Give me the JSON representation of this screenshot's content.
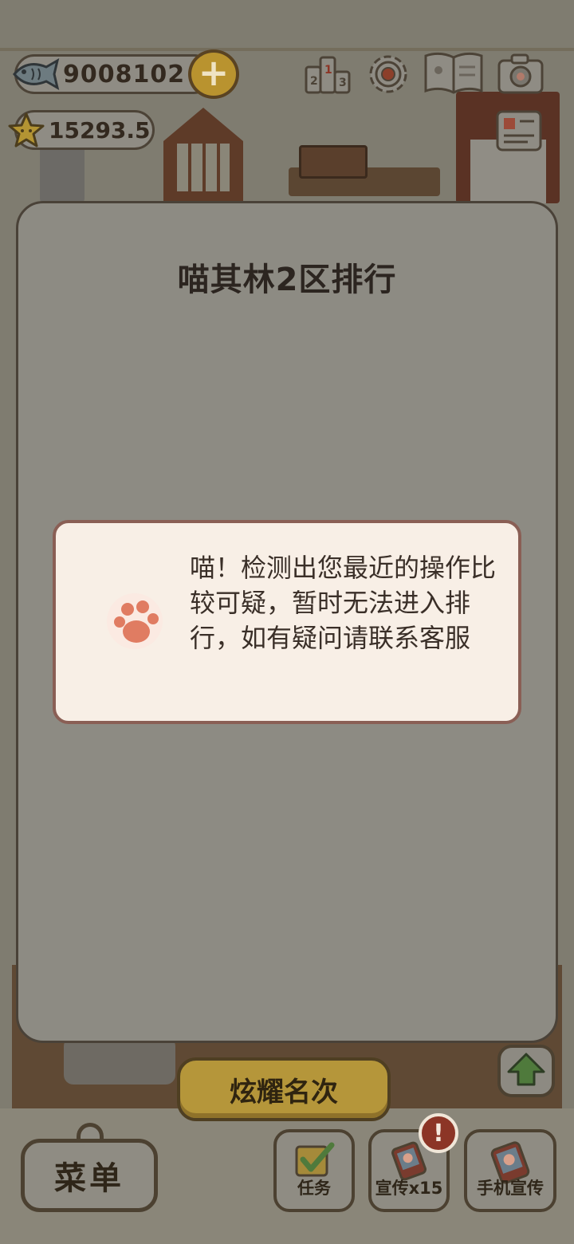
{
  "hud": {
    "fish_count": "9008102",
    "star_count": "15293.5",
    "plus_symbol": "+",
    "icons": [
      "fish-icon",
      "plus-icon",
      "star-icon",
      "ranking-icon",
      "settings-icon",
      "book-icon",
      "camera-icon",
      "notice-card-icon"
    ]
  },
  "modal": {
    "title": "喵其林2区排行"
  },
  "toast": {
    "icon": "paw-icon",
    "message": "喵！检测出您最近的操作比较可疑，暂时无法进入排行，如有疑问请联系客服"
  },
  "bottom": {
    "show_rank_label": "炫耀名次",
    "menu_label": "菜单",
    "task_label": "任务",
    "promo_label": "宣传x15",
    "phone_promo_label": "手机宣传",
    "badge_text": "!"
  },
  "colors": {
    "overlay": "#8d8b83",
    "toast_bg": "#f8efe6",
    "toast_border": "#8a5f55",
    "paw": "#e07c62",
    "gold_button": "#b5963a",
    "badge": "#8c3526"
  }
}
